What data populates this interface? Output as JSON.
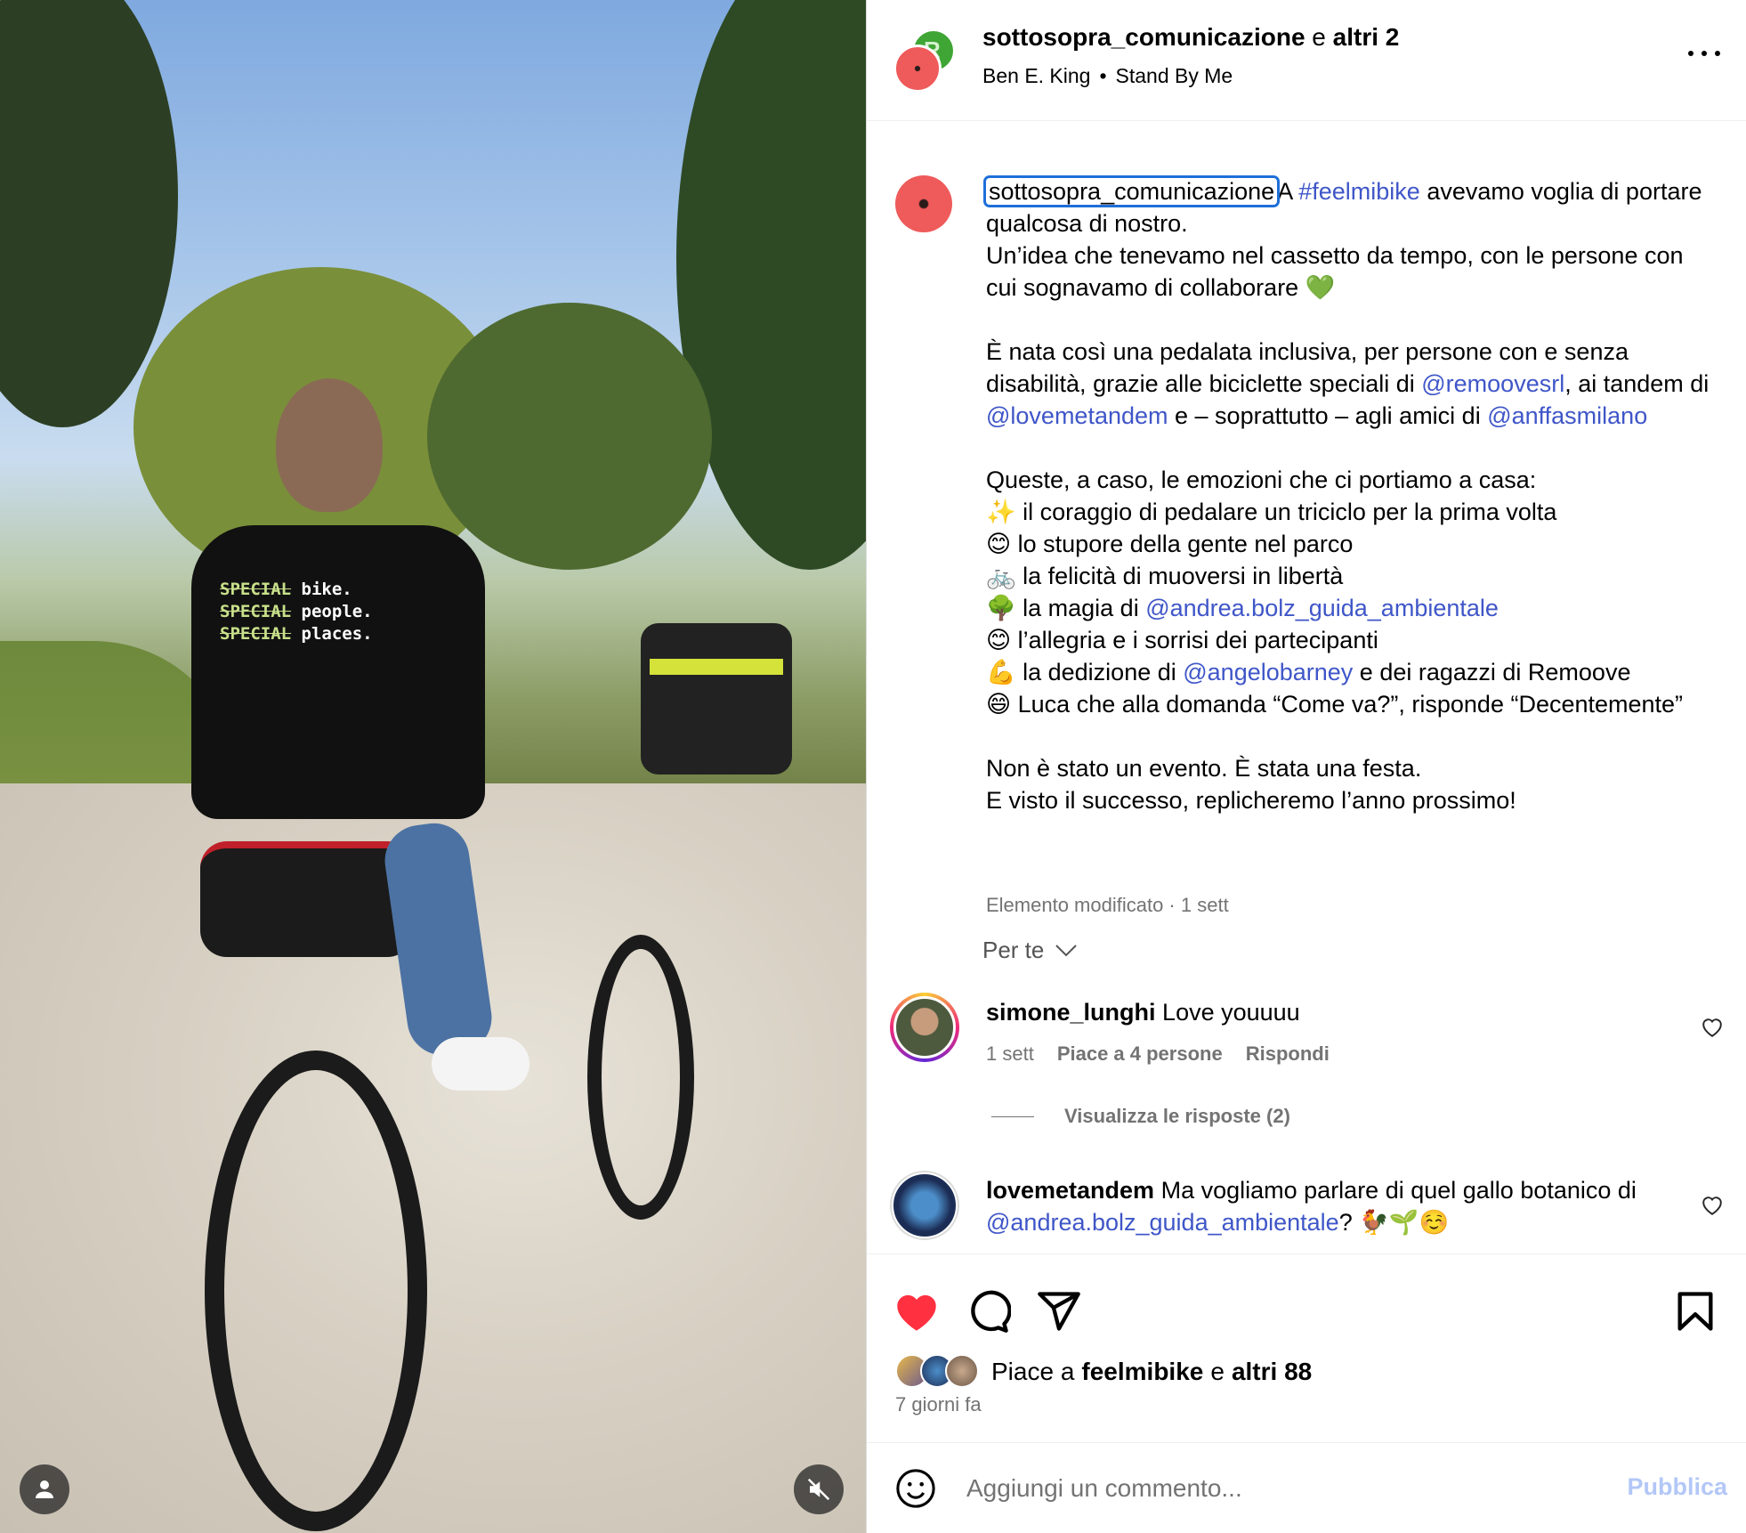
{
  "post": {
    "header": {
      "username": "sottosopra_comunicazione",
      "connector": "e",
      "others": "altri 2",
      "artist": "Ben E. King",
      "song": "Stand By Me"
    },
    "caption": {
      "username": "sottosopra_comunicazione",
      "p1_before": "A ",
      "hashtag": "#feelmibike",
      "p1_after": " avevamo voglia di portare qualcosa di nostro.\nUn’idea che tenevamo nel cassetto da tempo, con le persone con cui sognavamo di collaborare 💚\n\nÈ nata così una pedalata inclusiva, per persone con e senza disabilità, grazie alle biciclette speciali di ",
      "m1": "@remoovesrl",
      "t2": ", ai tandem di ",
      "m2": "@lovemetandem",
      "t3": " e – soprattutto – agli amici di ",
      "m3": "@anffasmilano",
      "t4": "\n\nQueste, a caso, le emozioni che ci portiamo a casa:\n✨ il coraggio di pedalare un triciclo per la prima volta\n😊 lo stupore della gente nel parco\n🚲 la felicità di muoversi in libertà\n🌳 la magia di ",
      "m4": "@andrea.bolz_guida_ambientale",
      "t5": "\n😊 l’allegria e i sorrisi dei partecipanti\n💪 la dedizione di ",
      "m5": "@angelobarney",
      "t6": " e dei ragazzi di Remoove\n😄 Luca che alla domanda “Come va?”, risponde “Decentemente”\n\nNon è stato un evento. È stata una festa.\nE visto il successo, replicheremo l’anno prossimo!",
      "meta": "Elemento modificato · 1 sett"
    },
    "for_you": "Per te",
    "comments": [
      {
        "username": "simone_lunghi",
        "text": "Love youuuu",
        "time": "1 sett",
        "likes": "Piace a 4 persone",
        "reply": "Rispondi",
        "view_replies": "Visualizza le risposte (2)"
      },
      {
        "username": "lovemetandem",
        "text_before": "Ma vogliamo parlare di quel gallo botanico di ",
        "mention": "@andrea.bolz_guida_ambientale",
        "text_after": "? 🐓🌱☺️"
      }
    ],
    "likes": {
      "prefix": "Piace a",
      "first_user": "feelmibike",
      "connector": "e",
      "others": "altri 88"
    },
    "time_ago": "7 giorni fa",
    "add_comment": {
      "placeholder": "Aggiungi un commento...",
      "publish": "Pubblica"
    },
    "media": {
      "shirt_lines": [
        {
          "strike": "SPECIAL",
          "word": "bike."
        },
        {
          "strike": "SPECIAL",
          "word": "people."
        },
        {
          "strike": "SPECIAL",
          "word": "places."
        }
      ]
    },
    "icons": {
      "tag_user": "user-icon",
      "mute": "speaker-muted-icon",
      "like": "heart-icon",
      "comment": "comment-icon",
      "share": "share-icon",
      "save": "bookmark-icon",
      "emoji": "emoji-icon",
      "more": "more-icon",
      "chevron": "chevron-down-icon"
    },
    "colors": {
      "link": "#3f56c8",
      "like_red": "#ff3040",
      "muted": "#737373",
      "publish_disabled": "#b3c7f7"
    }
  }
}
